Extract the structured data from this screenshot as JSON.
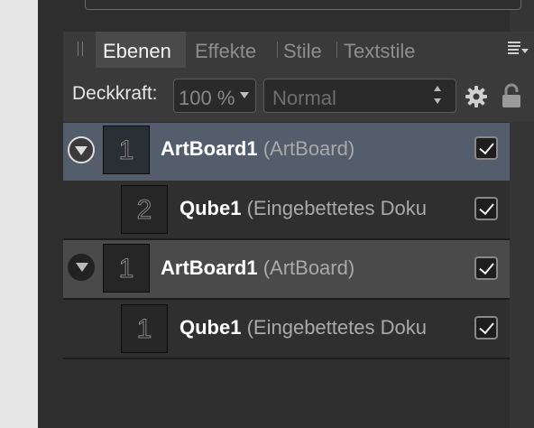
{
  "tabs": [
    {
      "label": "Ebenen",
      "active": true
    },
    {
      "label": "Effekte",
      "active": false
    },
    {
      "label": "Stile",
      "active": false
    },
    {
      "label": "Textstile",
      "active": false
    }
  ],
  "toolbar": {
    "opacity_label": "Deckkraft:",
    "opacity_value": "100 %",
    "blend_mode": "Normal",
    "icons": [
      "gear-icon",
      "lock-icon",
      "panel-menu-icon"
    ]
  },
  "layers": [
    {
      "thumb": "1",
      "name": "ArtBoard1",
      "type": "(ArtBoard)",
      "selected": true,
      "expanded": true,
      "visible": true
    },
    {
      "thumb": "2",
      "name": "Qube1",
      "type": "(Eingebettetes Doku",
      "selected": false,
      "visible": true
    },
    {
      "thumb": "1",
      "name": "ArtBoard1",
      "type": "(ArtBoard)",
      "selected": false,
      "expanded": true,
      "visible": true
    },
    {
      "thumb": "1",
      "name": "Qube1",
      "type": "(Eingebettetes Doku",
      "selected": false,
      "visible": true
    }
  ],
  "colors": {
    "panel_bg": "#2e2e2e",
    "selected_row": "#535d6c",
    "active_tab": "#4a4a4a"
  }
}
